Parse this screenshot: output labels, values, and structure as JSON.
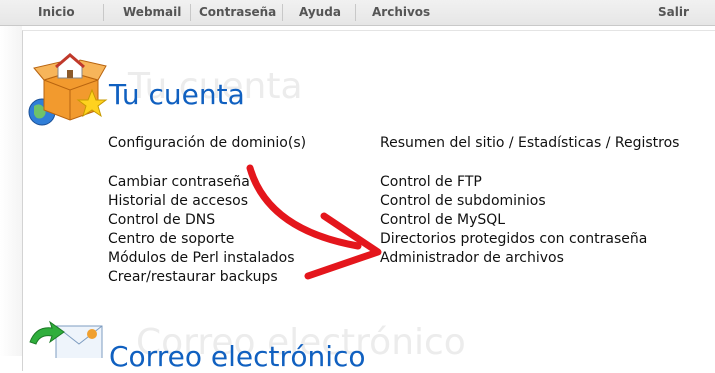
{
  "nav": {
    "items": [
      "Inicio",
      "Webmail",
      "Contraseña",
      "Ayuda",
      "Archivos"
    ],
    "logout": "Salir"
  },
  "account": {
    "title": "Tu cuenta",
    "ghost": "Tu cuenta",
    "domain_config": "Configuración de dominio(s)",
    "site_summary": "Resumen del sitio / Estadísticas / Registros",
    "left_links": [
      "Cambiar contraseña",
      "Historial de accesos",
      "Control de DNS",
      "Centro de soporte",
      "Módulos de Perl instalados",
      "Crear/restaurar backups"
    ],
    "right_links": [
      "Control de FTP",
      "Control de subdominios",
      "Control de MySQL",
      "Directorios protegidos con contraseña",
      "Administrador de archivos"
    ]
  },
  "email": {
    "title": "Correo electrónico",
    "ghost": "Correo electrónico"
  },
  "colors": {
    "accent_blue": "#1060c0",
    "arrow_red": "#e4161c",
    "box_orange": "#f29a2e"
  },
  "icons": [
    "account-box-icon",
    "mail-envelope-icon",
    "red-arrow-annotation"
  ]
}
